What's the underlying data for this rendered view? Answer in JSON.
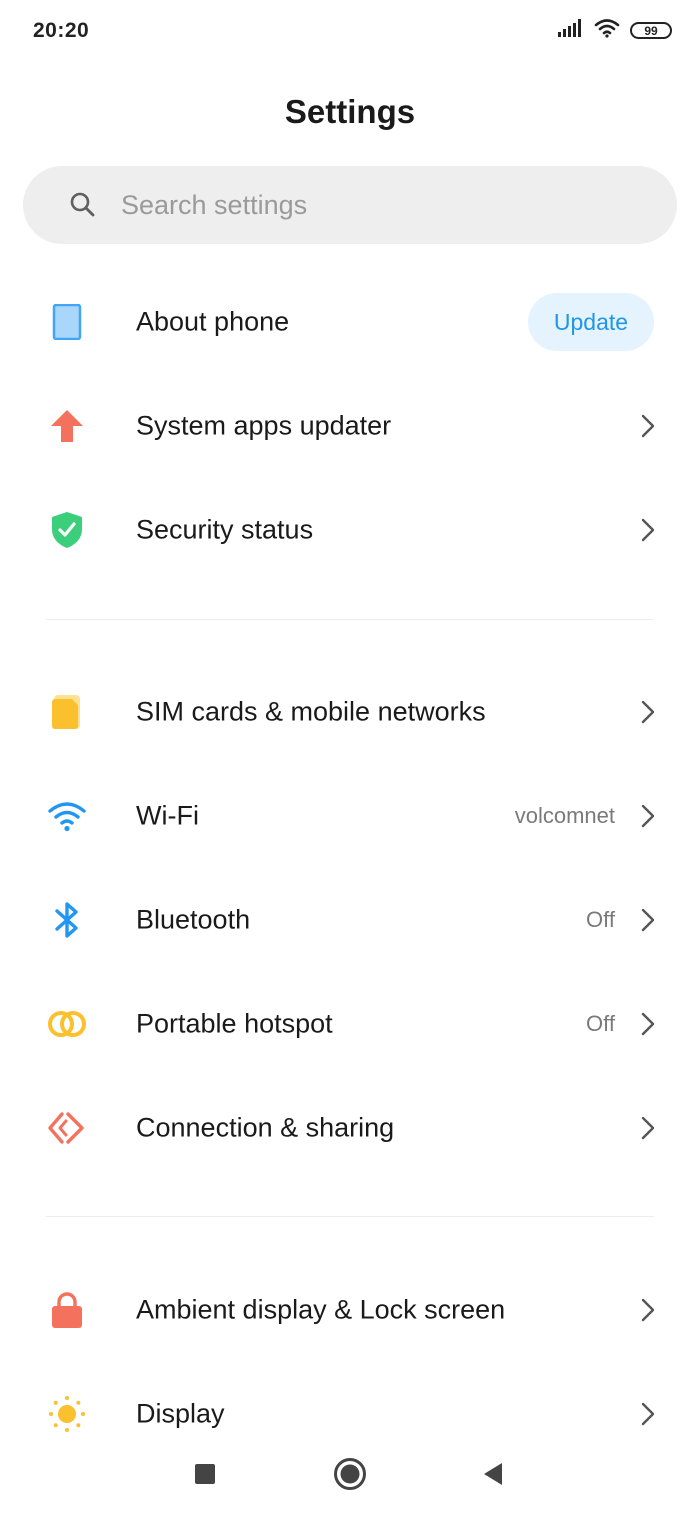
{
  "status_bar": {
    "time": "20:20",
    "battery_level": "99",
    "icons": [
      "signal-icon",
      "wifi-icon",
      "battery-icon"
    ]
  },
  "page": {
    "title": "Settings"
  },
  "search": {
    "placeholder": "Search settings",
    "value": ""
  },
  "colors": {
    "about_phone_icon": "#42a5f5",
    "system_apps_updater_icon": "#f4725d",
    "security_icon": "#3ccf7b",
    "sim_icon": "#fbc02d",
    "wifi_icon": "#2196f3",
    "bluetooth_icon": "#2196f3",
    "hotspot_icon": "#fbc02d",
    "connection_icon": "#f4725d",
    "lock_icon": "#f4725d",
    "display_icon": "#fbc02d",
    "update_text": "#2196e8",
    "update_bg": "#e4f3fd"
  },
  "sections": [
    {
      "items": [
        {
          "icon": "phone-icon",
          "label": "About phone",
          "action_label": "Update"
        },
        {
          "icon": "arrow-up-icon",
          "label": "System apps updater"
        },
        {
          "icon": "shield-check-icon",
          "label": "Security status"
        }
      ]
    },
    {
      "items": [
        {
          "icon": "sim-card-icon",
          "label": "SIM cards & mobile networks"
        },
        {
          "icon": "wifi-icon",
          "label": "Wi-Fi",
          "value": "volcomnet"
        },
        {
          "icon": "bluetooth-icon",
          "label": "Bluetooth",
          "value": "Off"
        },
        {
          "icon": "hotspot-icon",
          "label": "Portable hotspot",
          "value": "Off"
        },
        {
          "icon": "connection-sharing-icon",
          "label": "Connection & sharing"
        }
      ]
    },
    {
      "items": [
        {
          "icon": "lock-icon",
          "label": "Ambient display & Lock screen"
        },
        {
          "icon": "sun-icon",
          "label": "Display"
        }
      ]
    }
  ],
  "nav_bar": {
    "buttons": [
      "recents-square-icon",
      "home-circle-icon",
      "back-triangle-icon"
    ]
  }
}
